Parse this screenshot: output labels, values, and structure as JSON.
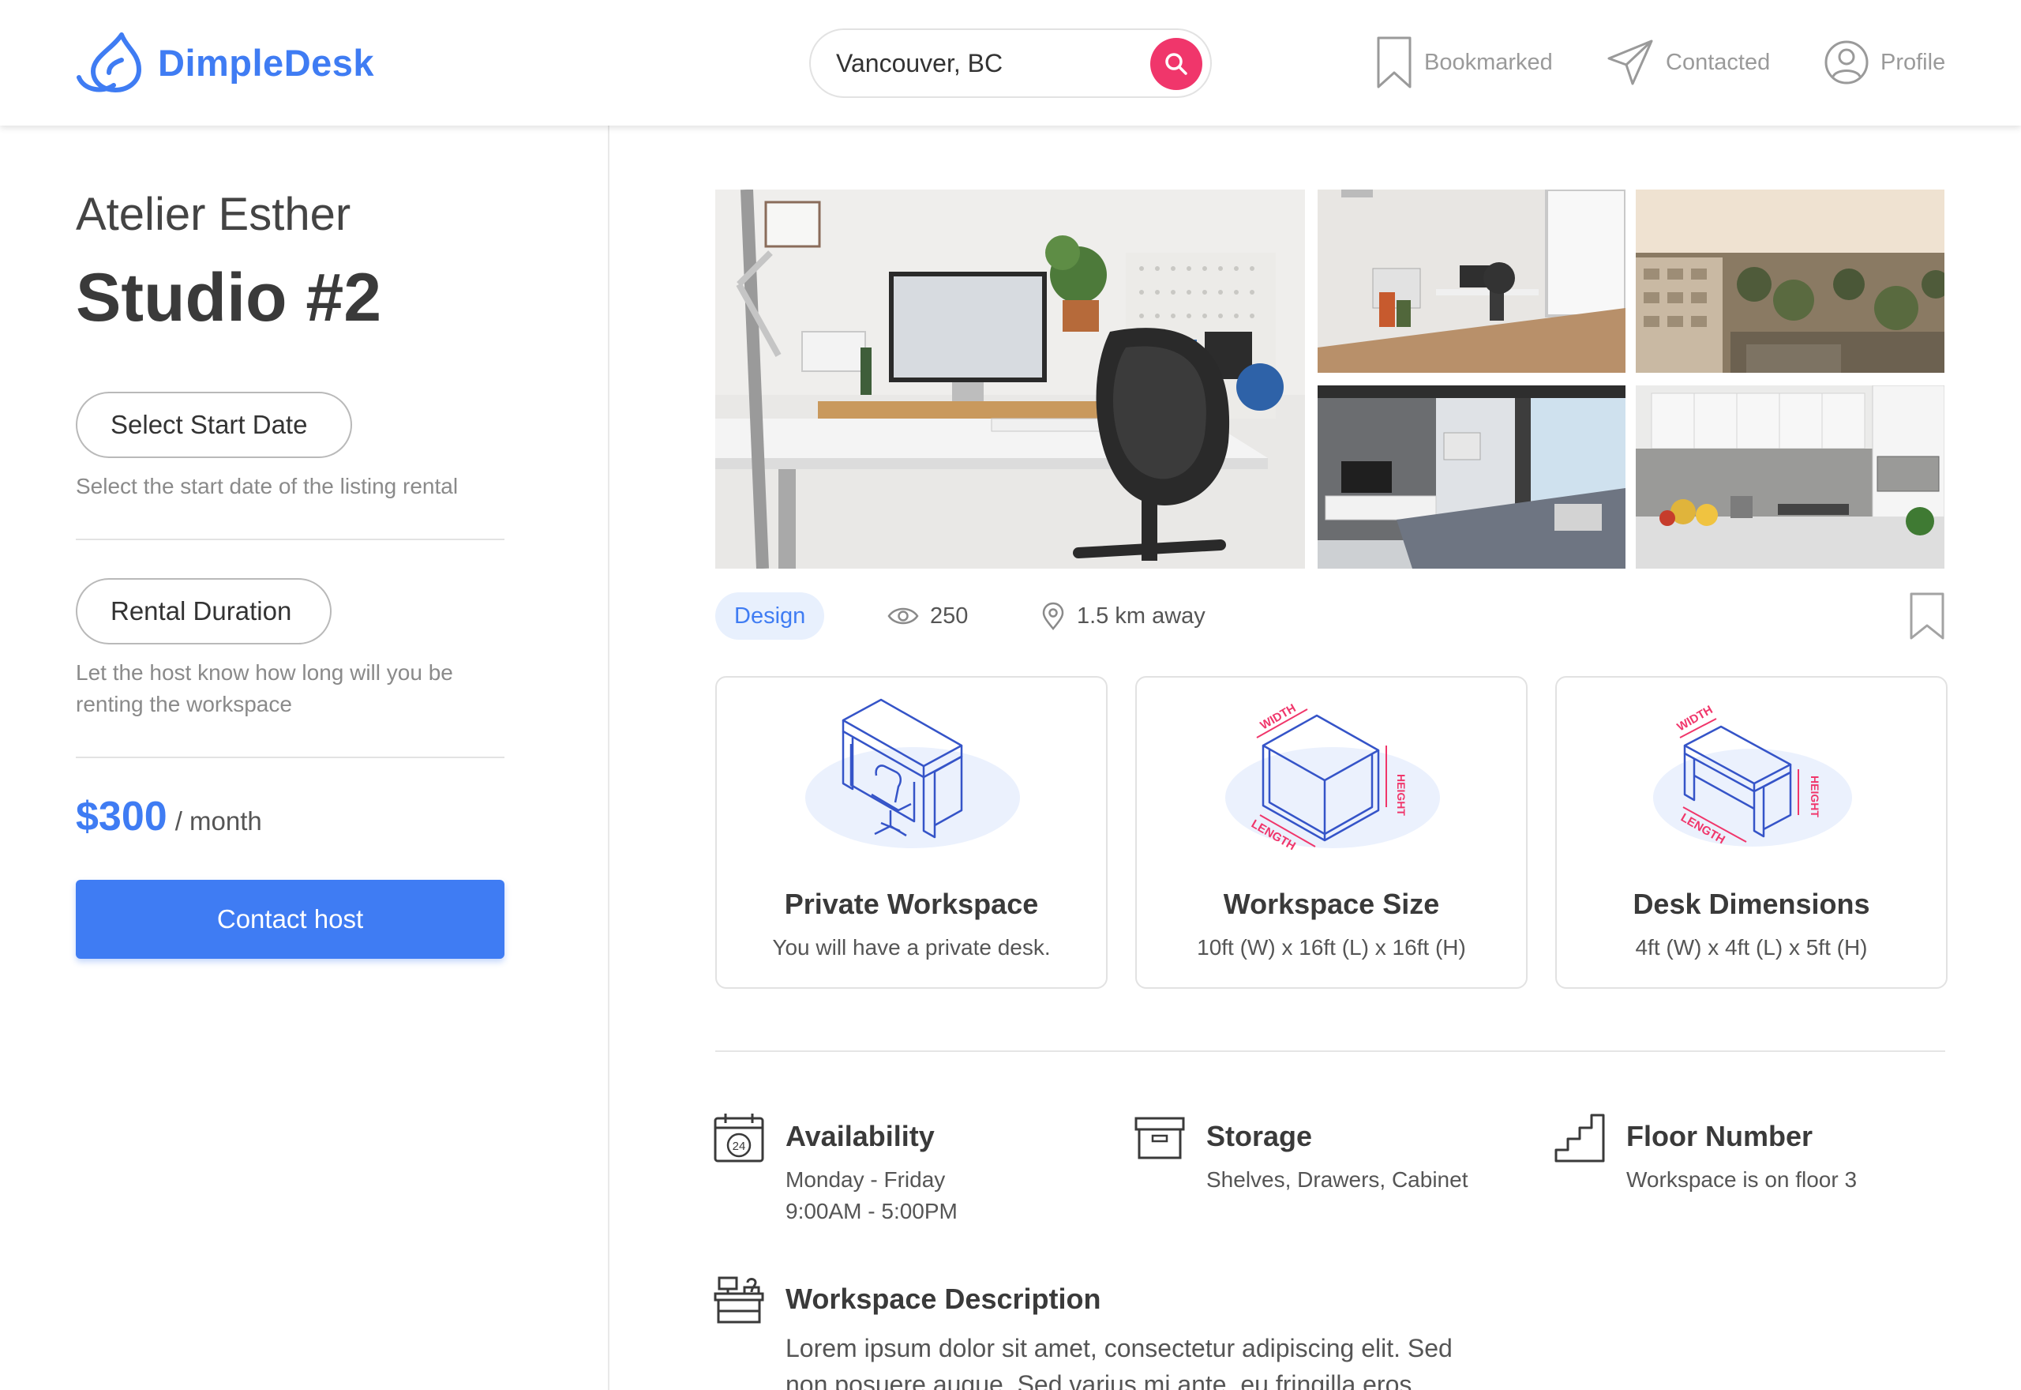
{
  "header": {
    "brand": "DimpleDesk",
    "search_value": "Vancouver, BC",
    "nav": {
      "bookmarked": "Bookmarked",
      "contacted": "Contacted",
      "profile": "Profile"
    }
  },
  "listing": {
    "host": "Atelier Esther",
    "title": "Studio #2",
    "start_date_button": "Select Start Date",
    "start_date_help": "Select the start date of the listing rental",
    "duration_button": "Rental Duration",
    "duration_help": "Let the host know how long will you be renting the workspace",
    "price": "$300",
    "price_unit": "/ month",
    "contact_button": "Contact host"
  },
  "meta": {
    "tag": "Design",
    "views": "250",
    "distance": "1.5 km away"
  },
  "cards": [
    {
      "title": "Private Workspace",
      "subtitle": "You will have a private desk."
    },
    {
      "title": "Workspace Size",
      "subtitle": "10ft (W) x 16ft (L) x 16ft (H)"
    },
    {
      "title": "Desk Dimensions",
      "subtitle": "4ft (W) x 4ft (L) x 5ft (H)"
    }
  ],
  "illustration_labels": {
    "width": "WIDTH",
    "height": "HEIGHT",
    "length": "LENGTH"
  },
  "features": {
    "availability": {
      "title": "Availability",
      "line1": "Monday - Friday",
      "line2": "9:00AM - 5:00PM",
      "icon_text": "24"
    },
    "storage": {
      "title": "Storage",
      "text": "Shelves, Drawers, Cabinet"
    },
    "floor": {
      "title": "Floor Number",
      "text": "Workspace is on floor 3"
    }
  },
  "description": {
    "title": "Workspace Description",
    "text": "Lorem ipsum dolor sit amet, consectetur adipiscing elit. Sed non posuere augue. Sed varius mi ante, eu fringilla eros."
  },
  "colors": {
    "brand": "#3f7cf3",
    "accent": "#f0366b",
    "tag_bg": "#e8f0fd"
  },
  "icons": [
    "logo-icon",
    "search-icon",
    "bookmark-icon",
    "paper-plane-icon",
    "user-circle-icon",
    "eye-icon",
    "location-pin-icon",
    "calendar-icon",
    "archive-box-icon",
    "stairs-icon",
    "desk-icon"
  ]
}
